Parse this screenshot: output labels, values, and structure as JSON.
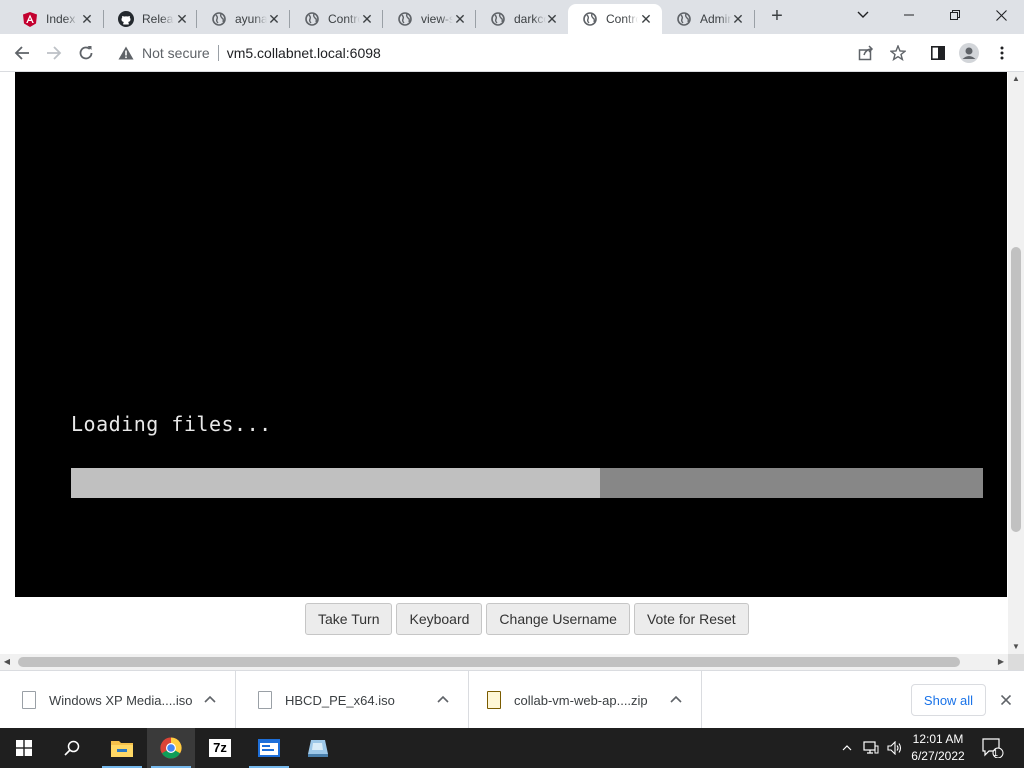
{
  "browser": {
    "tabs": [
      {
        "title": "Index",
        "icon": "angular-icon",
        "active": false
      },
      {
        "title": "Releases",
        "icon": "github-icon",
        "active": false
      },
      {
        "title": "ayunami",
        "icon": "globe-icon",
        "active": false
      },
      {
        "title": "Contro",
        "icon": "globe-icon",
        "active": false
      },
      {
        "title": "view-s",
        "icon": "globe-icon",
        "active": false
      },
      {
        "title": "darkco",
        "icon": "globe-icon",
        "active": false
      },
      {
        "title": "Contro",
        "icon": "globe-icon",
        "active": true
      },
      {
        "title": "Admin",
        "icon": "globe-icon",
        "active": false
      }
    ],
    "security_label": "Not secure",
    "url": "vm5.collabnet.local:6098"
  },
  "vm": {
    "loading_text": "Loading files...",
    "progress": 0.58,
    "buttons": {
      "take_turn": "Take Turn",
      "keyboard": "Keyboard",
      "change_username": "Change Username",
      "vote_reset": "Vote for Reset"
    }
  },
  "downloads": {
    "items": [
      {
        "name": "Windows XP Media....iso",
        "icon": "file-icon"
      },
      {
        "name": "HBCD_PE_x64.iso",
        "icon": "file-icon"
      },
      {
        "name": "collab-vm-web-ap....zip",
        "icon": "zip-file-icon"
      }
    ],
    "show_all": "Show all"
  },
  "taskbar": {
    "time": "12:01 AM",
    "date": "6/27/2022",
    "notification_count": "1",
    "pinned": [
      "windows-start-icon",
      "search-icon",
      "file-explorer-icon",
      "chrome-icon",
      "7zip-icon",
      "app-window-icon",
      "disk-image-icon"
    ]
  },
  "colors": {
    "tab_strip": "#dee1e6",
    "vm_background": "#000000",
    "progress_fill": "#c0c0c0",
    "progress_track": "#878787",
    "link_blue": "#1a73e8",
    "taskbar": "#1f1f1f"
  }
}
